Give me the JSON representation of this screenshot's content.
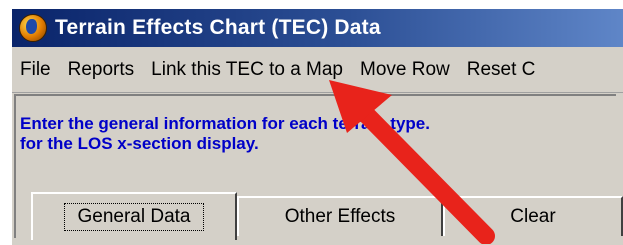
{
  "window": {
    "title": "Terrain Effects Chart (TEC) Data",
    "icon": "globe-icon"
  },
  "menu": {
    "items": [
      "File",
      "Reports",
      "Link this TEC to a Map",
      "Move Row",
      "Reset C"
    ]
  },
  "instructions": {
    "line1": "Enter the general information for each terrain type.",
    "line2": "for the LOS x-section display."
  },
  "tabs": {
    "general": "General Data",
    "other": "Other Effects",
    "clear": "Clear"
  },
  "annotation": {
    "arrow_color": "#e8231b",
    "arrow_points_to": "Link this TEC to a Map"
  },
  "colors": {
    "title_bar": "#0a246a",
    "window_face": "#d4d0c8",
    "instruction_text": "#0000c8"
  }
}
